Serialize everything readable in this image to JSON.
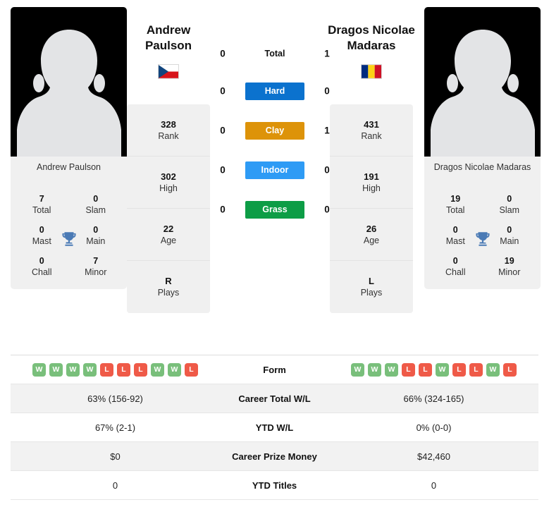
{
  "players": {
    "left": {
      "name": "Andrew Paulson",
      "name_line1": "Andrew",
      "name_line2": "Paulson",
      "country": "Czech Republic",
      "flag": "cz-flag-icon",
      "avatar": "player-silhouette-icon",
      "titles": [
        {
          "value": "7",
          "label": "Total"
        },
        {
          "value": "0",
          "label": "Slam"
        },
        {
          "value": "0",
          "label": "Mast"
        },
        {
          "value": "0",
          "label": "Main"
        },
        {
          "value": "0",
          "label": "Chall"
        },
        {
          "value": "7",
          "label": "Minor"
        }
      ],
      "ranks": [
        {
          "value": "328",
          "label": "Rank"
        },
        {
          "value": "302",
          "label": "High"
        },
        {
          "value": "22",
          "label": "Age"
        },
        {
          "value": "R",
          "label": "Plays"
        }
      ],
      "form": [
        "W",
        "W",
        "W",
        "W",
        "L",
        "L",
        "L",
        "W",
        "W",
        "L"
      ],
      "career_wl": "63% (156-92)",
      "ytd_wl": "67% (2-1)",
      "prize_money": "$0",
      "ytd_titles": "0"
    },
    "right": {
      "name": "Dragos Nicolae Madaras",
      "name_line1": "Dragos Nicolae",
      "name_line2": "Madaras",
      "country": "Romania",
      "flag": "ro-flag-icon",
      "avatar": "player-silhouette-icon",
      "titles": [
        {
          "value": "19",
          "label": "Total"
        },
        {
          "value": "0",
          "label": "Slam"
        },
        {
          "value": "0",
          "label": "Mast"
        },
        {
          "value": "0",
          "label": "Main"
        },
        {
          "value": "0",
          "label": "Chall"
        },
        {
          "value": "19",
          "label": "Minor"
        }
      ],
      "ranks": [
        {
          "value": "431",
          "label": "Rank"
        },
        {
          "value": "191",
          "label": "High"
        },
        {
          "value": "26",
          "label": "Age"
        },
        {
          "value": "L",
          "label": "Plays"
        }
      ],
      "form": [
        "W",
        "W",
        "W",
        "L",
        "L",
        "W",
        "L",
        "L",
        "W",
        "L"
      ],
      "career_wl": "66% (324-165)",
      "ytd_wl": "0% (0-0)",
      "prize_money": "$42,460",
      "ytd_titles": "0"
    }
  },
  "surfaces": [
    {
      "label": "Total",
      "left": "0",
      "right": "1",
      "color": "",
      "plain": true
    },
    {
      "label": "Hard",
      "left": "0",
      "right": "0",
      "color": "#0b72ce",
      "plain": false
    },
    {
      "label": "Clay",
      "left": "0",
      "right": "1",
      "color": "#dd9309",
      "plain": false
    },
    {
      "label": "Indoor",
      "left": "0",
      "right": "0",
      "color": "#2e9bf5",
      "plain": false
    },
    {
      "label": "Grass",
      "left": "0",
      "right": "0",
      "color": "#0d9d46",
      "plain": false
    }
  ],
  "comparison_rows": [
    {
      "label": "Form",
      "key": "form",
      "type": "badges"
    },
    {
      "label": "Career Total W/L",
      "key": "career_wl",
      "type": "text"
    },
    {
      "label": "YTD W/L",
      "key": "ytd_wl",
      "type": "text"
    },
    {
      "label": "Career Prize Money",
      "key": "prize_money",
      "type": "text"
    },
    {
      "label": "YTD Titles",
      "key": "ytd_titles",
      "type": "text"
    }
  ],
  "colors": {
    "hard": "#0b72ce",
    "clay": "#dd9309",
    "indoor": "#2e9bf5",
    "grass": "#0d9d46",
    "win_badge": "#79bf7b",
    "loss_badge": "#ef5a48",
    "trophy": "#4a7ab5",
    "card_bg": "#f0f0f0"
  }
}
